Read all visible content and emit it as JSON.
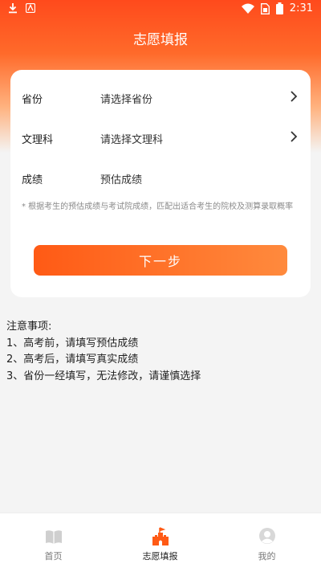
{
  "status": {
    "time": "2:31"
  },
  "title": "志愿填报",
  "form": {
    "rows": [
      {
        "label": "省份",
        "value": "请选择省份"
      },
      {
        "label": "文理科",
        "value": "请选择文理科"
      },
      {
        "label": "成绩",
        "value": "预估成绩"
      }
    ],
    "note": "* 根据考生的预估成绩与考试院成绩，匹配出适合考生的院校及测算录取概率",
    "next_label": "下一步"
  },
  "notes": {
    "heading": "注意事项:",
    "items": [
      "1、高考前，请填写预估成绩",
      "2、高考后，请填写真实成绩",
      "3、省份一经填写，无法修改，请谨慎选择"
    ]
  },
  "tabs": [
    {
      "label": "首页",
      "icon": "book-icon"
    },
    {
      "label": "志愿填报",
      "icon": "castle-icon"
    },
    {
      "label": "我的",
      "icon": "profile-icon"
    }
  ],
  "colors": {
    "accent": "#ff5a15",
    "active_tab": "#ff5a15",
    "inactive_tab": "#bdbdbd"
  }
}
